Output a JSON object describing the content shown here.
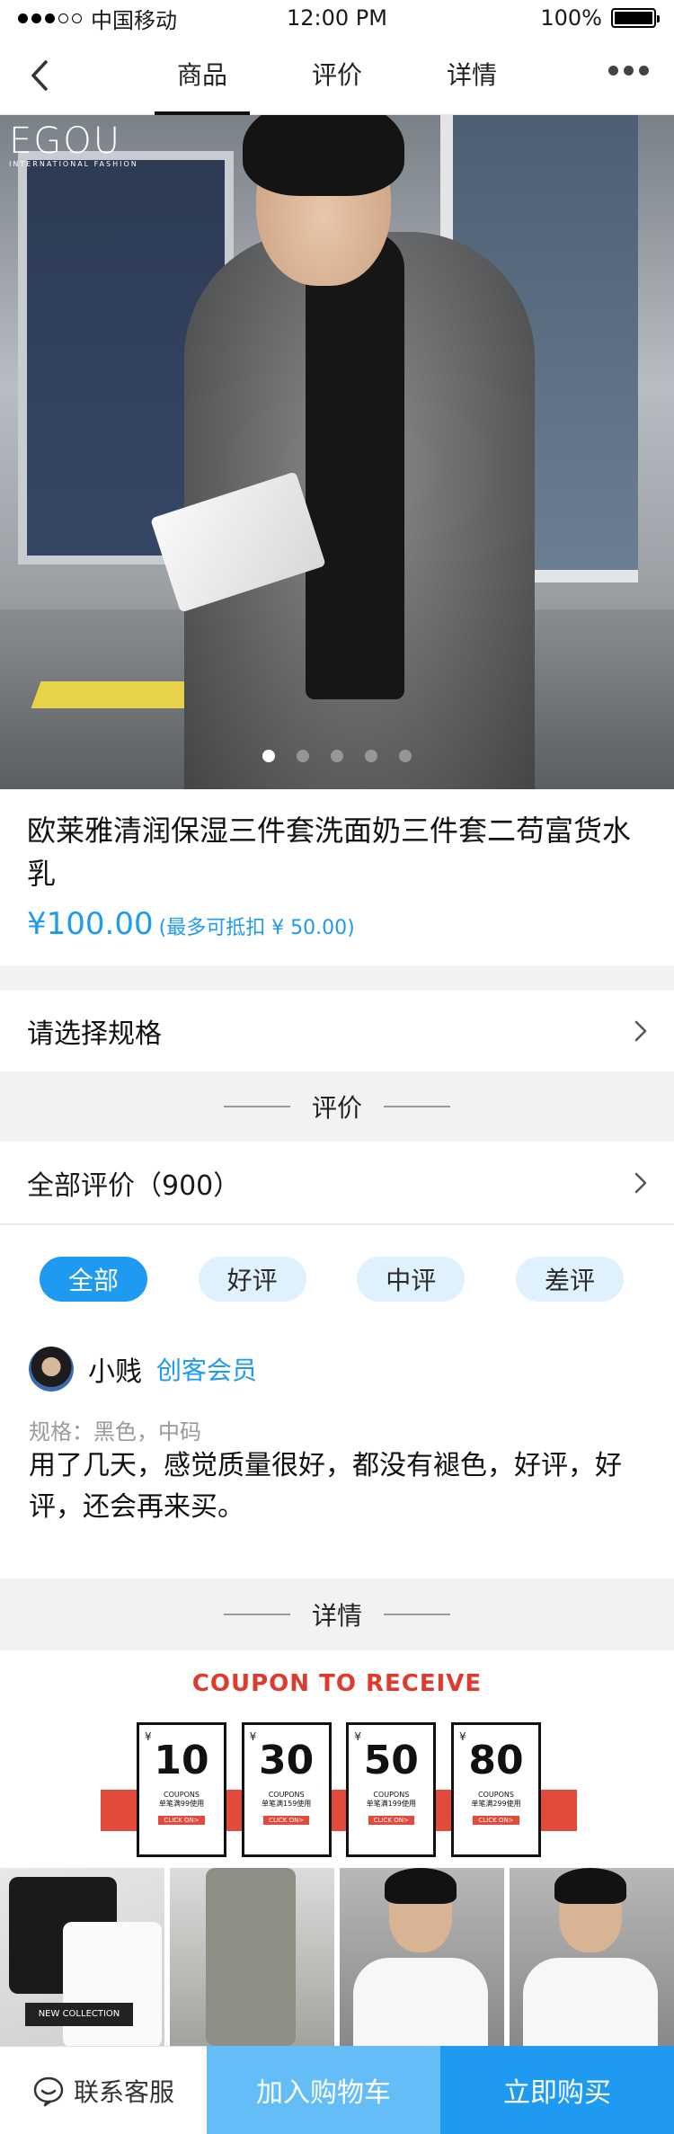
{
  "status_bar": {
    "carrier": "中国移动",
    "time": "12:00 PM",
    "battery": "100%",
    "battery_level": 1.0
  },
  "nav": {
    "tabs": [
      {
        "label": "商品",
        "active": true
      },
      {
        "label": "评价",
        "active": false
      },
      {
        "label": "详情",
        "active": false
      }
    ],
    "back_icon": "chevron-left-icon",
    "more_icon": "more-dots-icon"
  },
  "hero": {
    "logo": "EGOU",
    "logo_sub": "INTERNATIONAL FASHION",
    "slide_count": 5,
    "active_slide": 1
  },
  "product": {
    "title": "欧莱雅清润保湿三件套洗面奶三件套二苟富货水乳",
    "price": "¥100.00",
    "credit_note": "(最多可抵扣 ¥ 50.00)"
  },
  "spec": {
    "label": "请选择规格"
  },
  "reviews_section": {
    "title": "评价"
  },
  "all_reviews": {
    "label": "全部评价（900）"
  },
  "filters": [
    {
      "label": "全部",
      "active": true
    },
    {
      "label": "好评",
      "active": false
    },
    {
      "label": "中评",
      "active": false
    },
    {
      "label": "差评",
      "active": false
    }
  ],
  "review": {
    "name": "小贱",
    "member_tag": "创客会员",
    "spec": "规格：黑色，中码",
    "text": "用了几天，感觉质量很好，都没有褪色，好评，好评，还会再来买。"
  },
  "detail_section": {
    "title": "详情"
  },
  "detail": {
    "coupon_title": "COUPON TO RECEIVE",
    "coupons": [
      {
        "amount": "10",
        "cap1": "COUPONS",
        "cap2": "单笔满99使用",
        "btn": "CLICK ON>"
      },
      {
        "amount": "30",
        "cap1": "COUPONS",
        "cap2": "单笔满159使用",
        "btn": "CLICK ON>"
      },
      {
        "amount": "50",
        "cap1": "COUPONS",
        "cap2": "单笔满199使用",
        "btn": "CLICK ON>"
      },
      {
        "amount": "80",
        "cap1": "COUPONS",
        "cap2": "单笔满299使用",
        "btn": "CLICK ON>"
      }
    ],
    "coupon_yen": "¥",
    "photo_tag": "NEW COLLECTION"
  },
  "bottom_bar": {
    "service": "联系客服",
    "add_cart": "加入购物车",
    "buy_now": "立即购买"
  },
  "colors": {
    "accent": "#1e9af0",
    "accent_light": "#64bdf7",
    "coupon_red": "#e24b3c"
  }
}
